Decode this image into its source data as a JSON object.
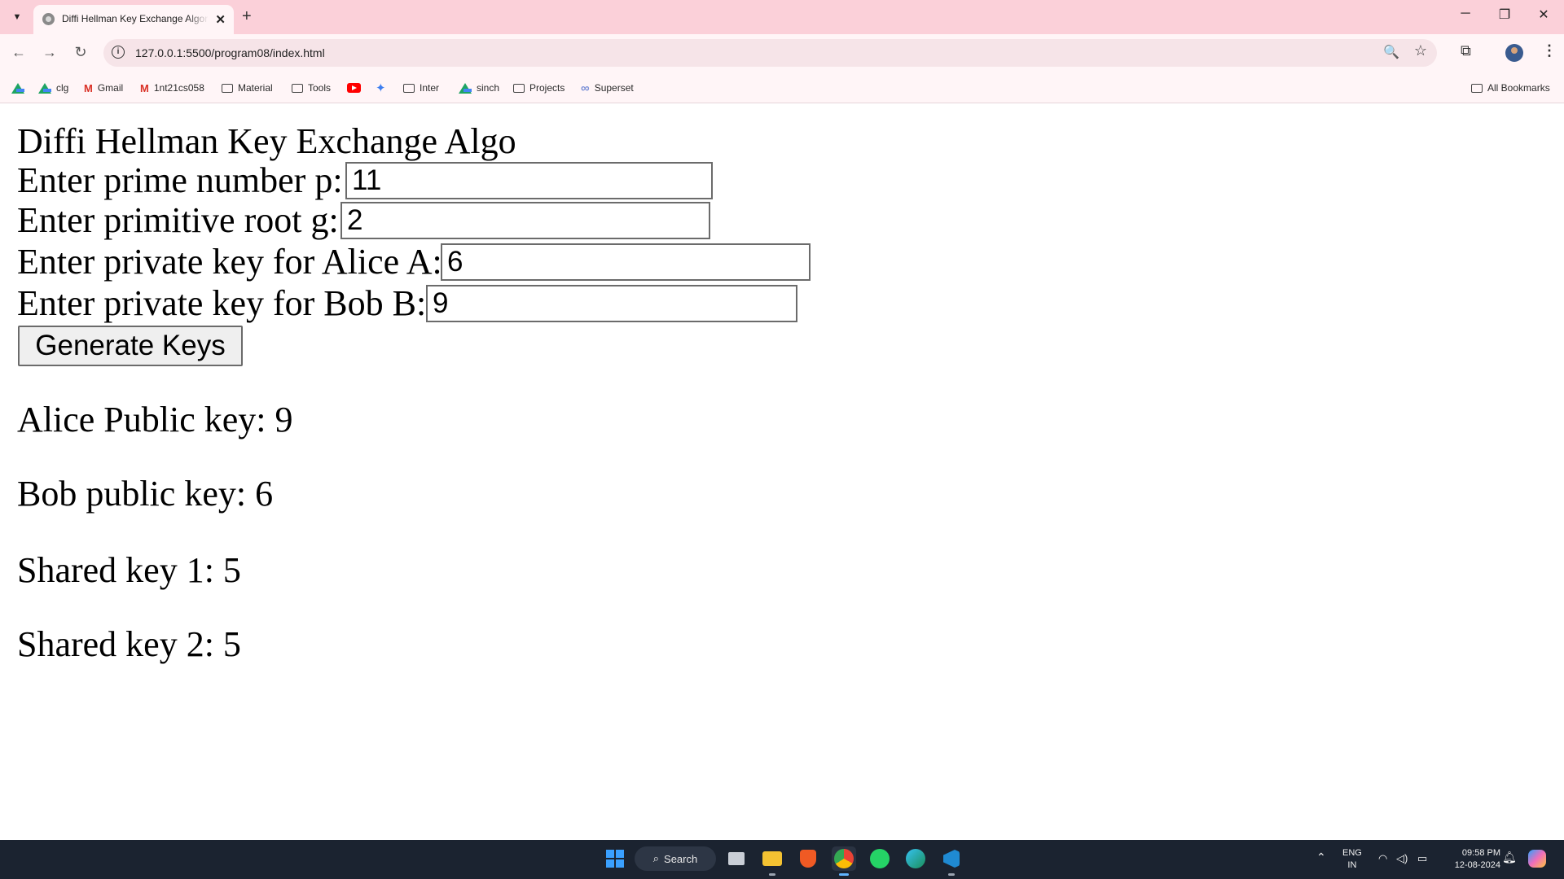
{
  "browser": {
    "tab_title": "Diffi Hellman Key Exchange Algorithm",
    "url": "127.0.0.1:5500/program08/index.html",
    "bookmarks": [
      {
        "label": "",
        "icon": "google-drive-icon"
      },
      {
        "label": "clg",
        "icon": "google-drive-icon"
      },
      {
        "label": "Gmail",
        "icon": "gmail-icon"
      },
      {
        "label": "1nt21cs058",
        "icon": "gmail-icon"
      },
      {
        "label": "Material",
        "icon": "folder-icon"
      },
      {
        "label": "Tools",
        "icon": "folder-icon"
      },
      {
        "label": "",
        "icon": "youtube-icon"
      },
      {
        "label": "",
        "icon": "gemini-icon"
      },
      {
        "label": "Inter",
        "icon": "folder-icon"
      },
      {
        "label": "sinch",
        "icon": "google-drive-icon"
      },
      {
        "label": "Projects",
        "icon": "folder-icon"
      },
      {
        "label": "Superset",
        "icon": "superset-icon"
      }
    ],
    "all_bookmarks": "All Bookmarks"
  },
  "page": {
    "heading": "Diffi Hellman Key Exchange Algo",
    "p_label": "Enter prime number p:",
    "p_value": "11",
    "g_label": "Enter primitive root g:",
    "g_value": "2",
    "a_label": "Enter private key for Alice A:",
    "a_value": "6",
    "b_label": "Enter private key for Bob B:",
    "b_value": "9",
    "button_label": "Generate Keys",
    "alice_public": "Alice Public key: 9",
    "bob_public": "Bob public key: 6",
    "shared_1": "Shared key 1: 5",
    "shared_2": "Shared key 2: 5"
  },
  "taskbar": {
    "search_label": "Search",
    "lang_line1": "ENG",
    "lang_line2": "IN",
    "time": "09:58 PM",
    "date": "12-08-2024"
  },
  "colors": {
    "tabstrip": "#fbd0d9",
    "toolbar": "#fff5f7",
    "taskbar": "#1b2330"
  }
}
